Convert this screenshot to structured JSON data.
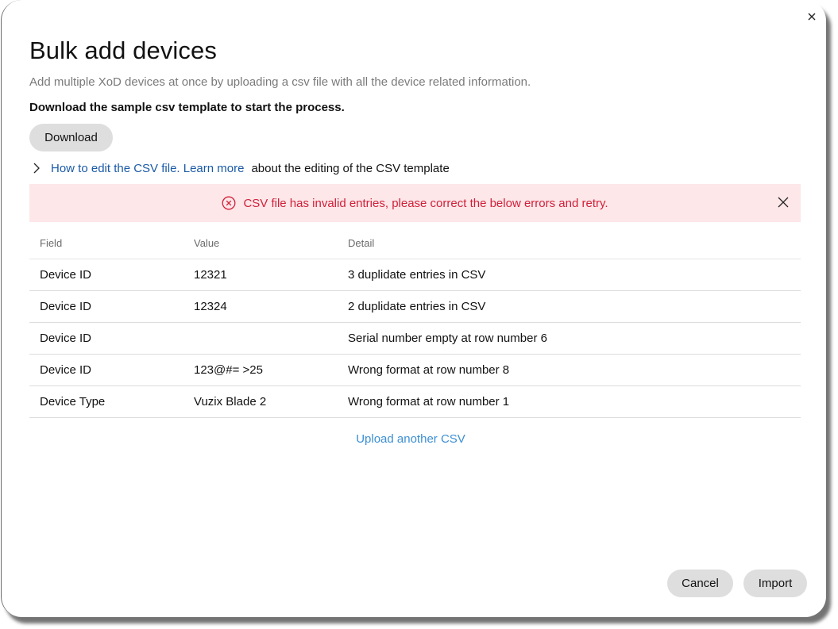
{
  "dialog": {
    "title": "Bulk add devices",
    "subtitle": "Add multiple XoD devices at once by uploading a csv file with all the device related information.",
    "instruction": "Download the sample csv template to start the process.",
    "close_icon": "close-icon"
  },
  "download": {
    "label": "Download"
  },
  "help": {
    "icon": "chevron-right-icon",
    "link_text": "How to edit the CSV file. Learn more",
    "suffix_text": "about the editing of the CSV template"
  },
  "error_banner": {
    "icon": "error-circle-x-icon",
    "message": "CSV file has invalid entries, please correct the below errors and retry.",
    "close_icon": "close-icon",
    "background": "#fde7e9",
    "text_color": "#d0203a"
  },
  "table": {
    "columns": [
      "Field",
      "Value",
      "Detail"
    ],
    "rows": [
      {
        "field": "Device ID",
        "value": "12321",
        "detail": "3 duplidate entries in CSV"
      },
      {
        "field": "Device ID",
        "value": "12324",
        "detail": "2 duplidate entries in CSV"
      },
      {
        "field": "Device ID",
        "value": "",
        "detail": "Serial number empty at row number 6"
      },
      {
        "field": "Device ID",
        "value": "123@#= >25",
        "detail": "Wrong format at row number 8"
      },
      {
        "field": "Device Type",
        "value": "Vuzix Blade 2",
        "detail": "Wrong format at row number 1"
      }
    ]
  },
  "upload_another": {
    "label": "Upload another CSV",
    "color": "#3c8fd4"
  },
  "footer": {
    "cancel_label": "Cancel",
    "import_label": "Import"
  }
}
